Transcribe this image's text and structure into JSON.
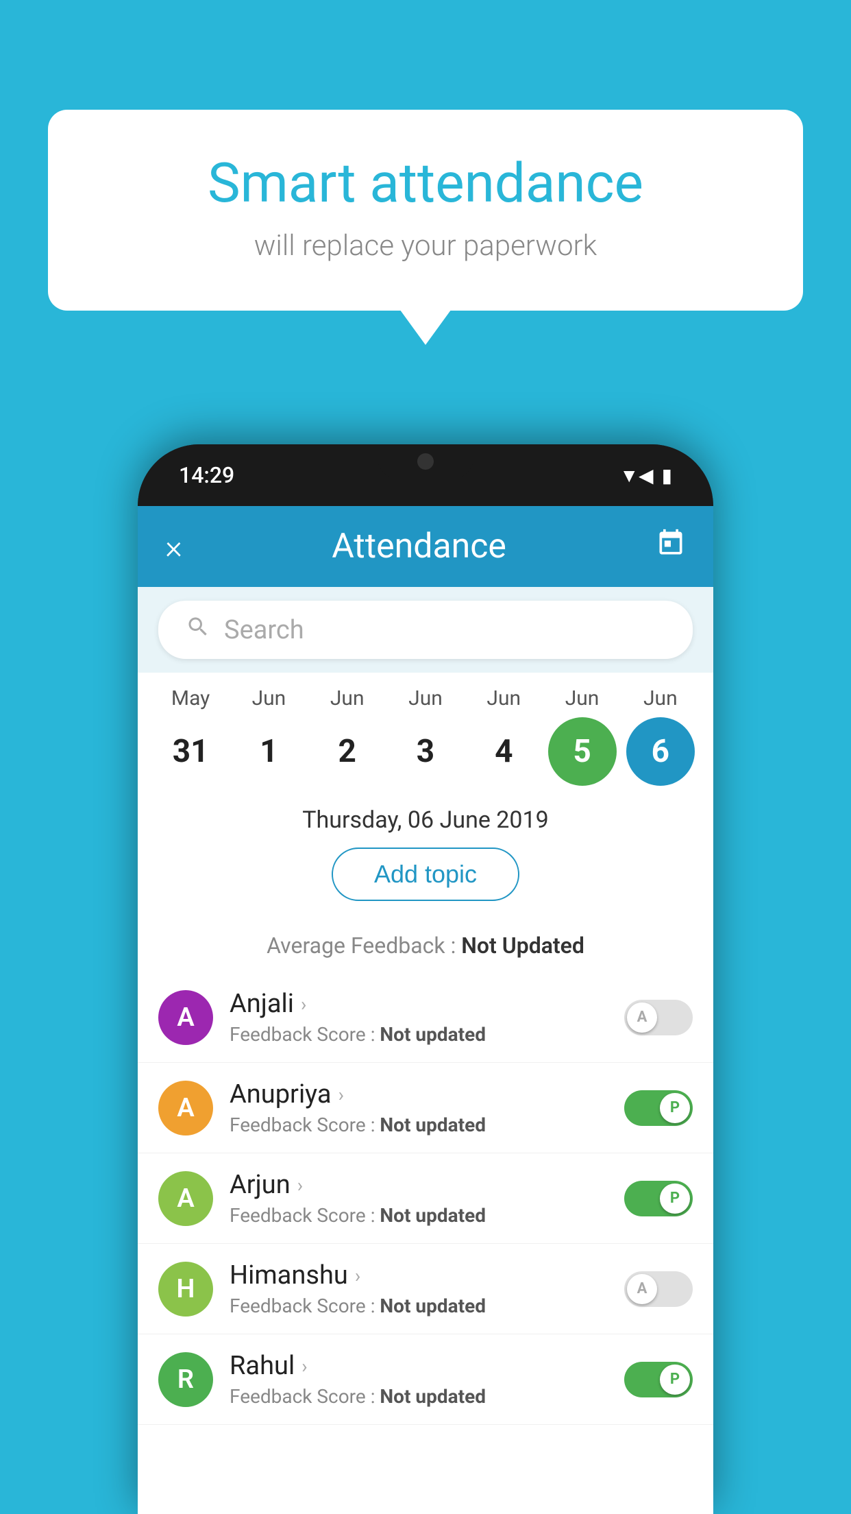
{
  "background_color": "#29b6d8",
  "bubble": {
    "title": "Smart attendance",
    "subtitle": "will replace your paperwork"
  },
  "phone": {
    "time": "14:29",
    "status_icons": [
      "wifi",
      "signal",
      "battery"
    ]
  },
  "header": {
    "close_label": "×",
    "title": "Attendance",
    "calendar_icon": "📅"
  },
  "search": {
    "placeholder": "Search"
  },
  "calendar": {
    "months": [
      "May",
      "Jun",
      "Jun",
      "Jun",
      "Jun",
      "Jun",
      "Jun"
    ],
    "days": [
      "31",
      "1",
      "2",
      "3",
      "4",
      "5",
      "6"
    ],
    "today_index": 5,
    "selected_index": 6
  },
  "selected_date": "Thursday, 06 June 2019",
  "add_topic_label": "Add topic",
  "avg_feedback": {
    "label": "Average Feedback : ",
    "value": "Not Updated"
  },
  "students": [
    {
      "name": "Anjali",
      "avatar_letter": "A",
      "avatar_color": "#9c27b0",
      "feedback": "Not updated",
      "attendance": "A",
      "toggle_on": false
    },
    {
      "name": "Anupriya",
      "avatar_letter": "A",
      "avatar_color": "#f0a030",
      "feedback": "Not updated",
      "attendance": "P",
      "toggle_on": true
    },
    {
      "name": "Arjun",
      "avatar_letter": "A",
      "avatar_color": "#8bc34a",
      "feedback": "Not updated",
      "attendance": "P",
      "toggle_on": true
    },
    {
      "name": "Himanshu",
      "avatar_letter": "H",
      "avatar_color": "#8bc34a",
      "feedback": "Not updated",
      "attendance": "A",
      "toggle_on": false
    },
    {
      "name": "Rahul",
      "avatar_letter": "R",
      "avatar_color": "#4caf50",
      "feedback": "Not updated",
      "attendance": "P",
      "toggle_on": true
    }
  ]
}
